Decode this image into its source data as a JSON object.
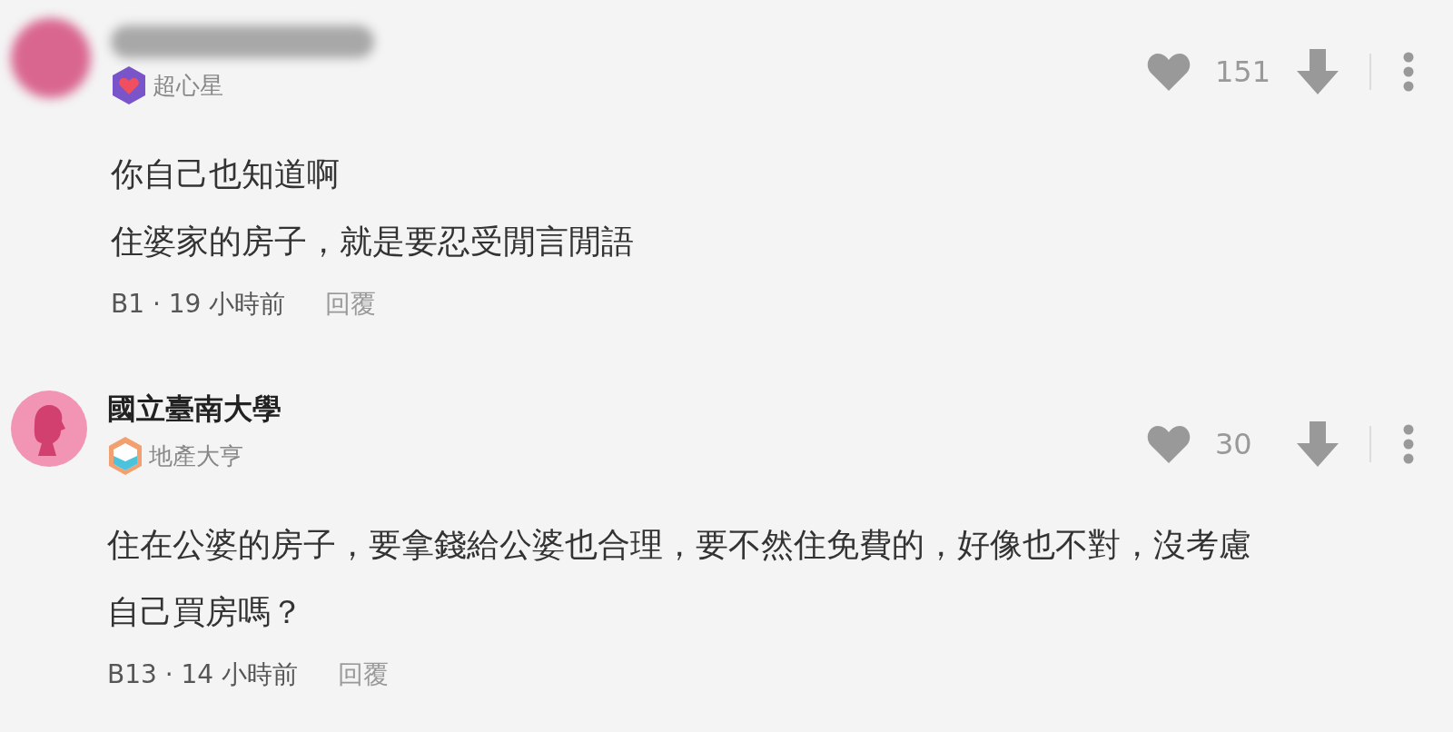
{
  "comments": [
    {
      "avatar": {
        "kind": "blurred"
      },
      "name_hidden": true,
      "badge": {
        "kind": "heart",
        "label": "超心星"
      },
      "likes": "151",
      "lines": [
        "你自己也知道啊",
        "住婆家的房子，就是要忍受閒言閒語"
      ],
      "meta": "B1 · 19 小時前",
      "reply": "回覆"
    },
    {
      "avatar": {
        "kind": "silhouette"
      },
      "name_hidden": false,
      "name": "國立臺南大學",
      "badge": {
        "kind": "cube",
        "label": "地產大亨"
      },
      "likes": "30",
      "lines": [
        "住在公婆的房子，要拿錢給公婆也合理，要不然住免費的，好像也不對，沒考慮",
        "自己買房嗎？"
      ],
      "meta": "B13 · 14 小時前",
      "reply": "回覆"
    }
  ]
}
